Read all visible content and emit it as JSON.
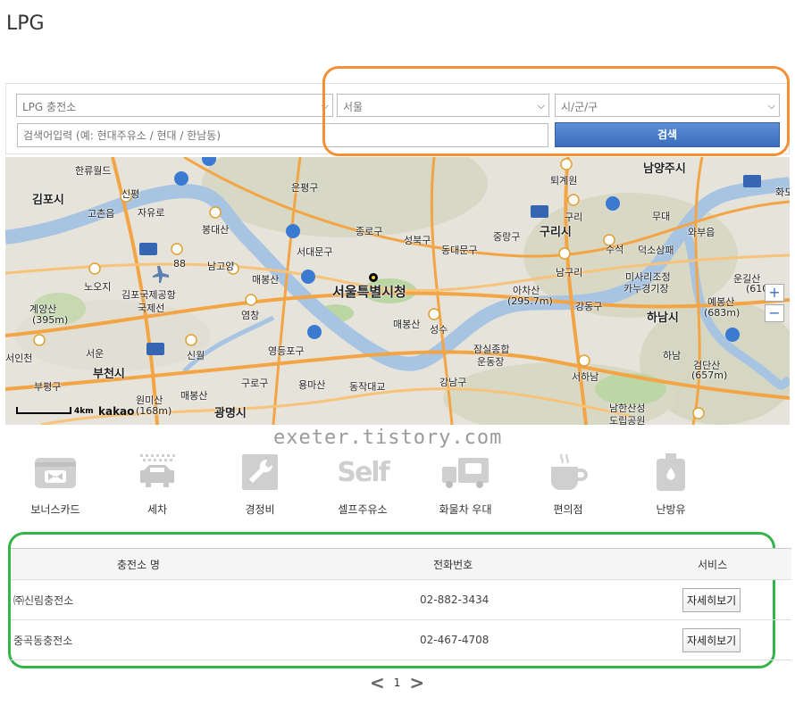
{
  "page": {
    "title": "LPG"
  },
  "search": {
    "type_select": "LPG 충전소",
    "city_select": "서울",
    "district_select": "시/군/구",
    "keyword_placeholder": "검색어입력 (예: 현대주유소 / 현대 / 한남동)",
    "button_label": "검색"
  },
  "map": {
    "labels": [
      {
        "text": "김포시",
        "style": "big"
      },
      {
        "text": "한류월드",
        "style": ""
      },
      {
        "text": "고촌읍",
        "style": ""
      },
      {
        "text": "신평",
        "style": ""
      },
      {
        "text": "자유로",
        "style": ""
      },
      {
        "text": "은평구",
        "style": ""
      },
      {
        "text": "종로구",
        "style": ""
      },
      {
        "text": "성북구",
        "style": ""
      },
      {
        "text": "중랑구",
        "style": ""
      },
      {
        "text": "구리시",
        "style": "big"
      },
      {
        "text": "남양주시",
        "style": "big"
      },
      {
        "text": "퇴계원",
        "style": ""
      },
      {
        "text": "봉대산",
        "style": ""
      },
      {
        "text": "서대문구",
        "style": ""
      },
      {
        "text": "동대문구",
        "style": ""
      },
      {
        "text": "구리",
        "style": ""
      },
      {
        "text": "무대",
        "style": ""
      },
      {
        "text": "와부읍",
        "style": ""
      },
      {
        "text": "남고양",
        "style": ""
      },
      {
        "text": "88",
        "style": ""
      },
      {
        "text": "노오지",
        "style": ""
      },
      {
        "text": "김포국제공항",
        "style": ""
      },
      {
        "text": "국제선",
        "style": ""
      },
      {
        "text": "계양산",
        "style": ""
      },
      {
        "text": "(395m)",
        "style": ""
      },
      {
        "text": "매봉산",
        "style": ""
      },
      {
        "text": "서울특별시청",
        "style": "huge"
      },
      {
        "text": "아차산",
        "style": ""
      },
      {
        "text": "(295.7m)",
        "style": ""
      },
      {
        "text": "남구리",
        "style": ""
      },
      {
        "text": "수석",
        "style": ""
      },
      {
        "text": "덕소삼패",
        "style": ""
      },
      {
        "text": "미사리조정",
        "style": ""
      },
      {
        "text": "카누경기장",
        "style": ""
      },
      {
        "text": "운길산",
        "style": ""
      },
      {
        "text": "(610",
        "style": ""
      },
      {
        "text": "예봉산",
        "style": ""
      },
      {
        "text": "(683m)",
        "style": ""
      },
      {
        "text": "하남시",
        "style": "big"
      },
      {
        "text": "강동구",
        "style": ""
      },
      {
        "text": "염창",
        "style": ""
      },
      {
        "text": "매봉산",
        "style": ""
      },
      {
        "text": "성수",
        "style": ""
      },
      {
        "text": "서인천",
        "style": ""
      },
      {
        "text": "서운",
        "style": ""
      },
      {
        "text": "신월",
        "style": ""
      },
      {
        "text": "영등포구",
        "style": ""
      },
      {
        "text": "잠실종합",
        "style": ""
      },
      {
        "text": "운동장",
        "style": ""
      },
      {
        "text": "하남",
        "style": ""
      },
      {
        "text": "검단산",
        "style": ""
      },
      {
        "text": "(657m)",
        "style": ""
      },
      {
        "text": "부천시",
        "style": "big"
      },
      {
        "text": "부평구",
        "style": ""
      },
      {
        "text": "구로구",
        "style": ""
      },
      {
        "text": "용마산",
        "style": ""
      },
      {
        "text": "동작대교",
        "style": ""
      },
      {
        "text": "강남구",
        "style": ""
      },
      {
        "text": "서하남",
        "style": ""
      },
      {
        "text": "원미산",
        "style": ""
      },
      {
        "text": "(168m)",
        "style": ""
      },
      {
        "text": "매봉산",
        "style": ""
      },
      {
        "text": "광명시",
        "style": "big"
      },
      {
        "text": "남한산성",
        "style": ""
      },
      {
        "text": "도립공원",
        "style": ""
      },
      {
        "text": "화도",
        "style": ""
      }
    ],
    "scale": "4km",
    "brand": "kakao",
    "zoom_in": "+",
    "zoom_out": "−"
  },
  "watermark": "exeter.tistory.com",
  "services": [
    {
      "label": "보너스카드",
      "icon": "card-icon"
    },
    {
      "label": "세차",
      "icon": "car-wash-icon"
    },
    {
      "label": "경정비",
      "icon": "wrench-icon"
    },
    {
      "label": "셀프주유소",
      "icon": "self-icon"
    },
    {
      "label": "화물차 우대",
      "icon": "truck-icon"
    },
    {
      "label": "편의점",
      "icon": "coffee-icon"
    },
    {
      "label": "난방유",
      "icon": "oil-can-icon"
    }
  ],
  "table": {
    "headers": [
      "충전소 명",
      "전화번호",
      "서비스"
    ],
    "rows": [
      {
        "name": "㈜신림충전소",
        "phone": "02-882-3434",
        "action": "자세히보기"
      },
      {
        "name": "중곡동충전소",
        "phone": "02-467-4708",
        "action": "자세히보기"
      }
    ]
  },
  "pager": {
    "prev": "<",
    "current": "1",
    "next": ">"
  }
}
